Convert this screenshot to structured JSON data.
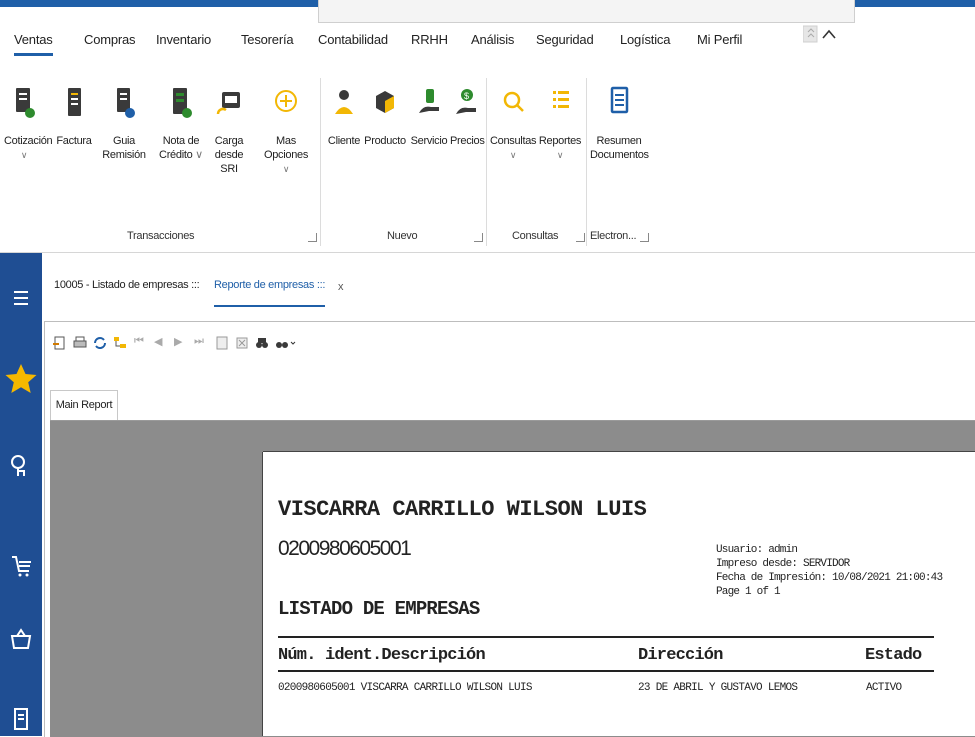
{
  "menu": {
    "tabs": [
      "Ventas",
      "Compras",
      "Inventario",
      "Tesorería",
      "Contabilidad",
      "RRHH",
      "Análisis",
      "Seguridad",
      "Logística",
      "Mi Perfil"
    ],
    "active_tab": "Ventas"
  },
  "ribbon": {
    "transacciones": {
      "label": "Transacciones",
      "buttons": [
        {
          "line1": "Cotización",
          "line2": "",
          "icon": "quote-document-icon"
        },
        {
          "line1": "Factura",
          "line2": "",
          "icon": "invoice-icon"
        },
        {
          "line1": "Guia Remisión",
          "line2": "",
          "icon": "remission-guide-icon"
        },
        {
          "line1": "Nota de",
          "line2": "Crédito",
          "icon": "credit-note-icon"
        },
        {
          "line1": "Carga",
          "line2": "desde SRI",
          "icon": "sri-upload-icon"
        },
        {
          "line1": "Mas Opciones",
          "line2": "",
          "icon": "plus-circle-icon"
        }
      ]
    },
    "nuevo": {
      "label": "Nuevo",
      "buttons": [
        {
          "line1": "Cliente",
          "icon": "client-person-icon"
        },
        {
          "line1": "Producto",
          "icon": "product-box-icon"
        },
        {
          "line1": "Servicio",
          "icon": "service-hand-icon"
        },
        {
          "line1": "Precios",
          "icon": "prices-dollar-icon"
        }
      ]
    },
    "consultas": {
      "label": "Consultas",
      "buttons": [
        {
          "line1": "Consultas",
          "icon": "search-icon"
        },
        {
          "line1": "Reportes",
          "icon": "reports-list-icon"
        }
      ]
    },
    "electron": {
      "label": "Electron...",
      "buttons": [
        {
          "line1": "Resumen",
          "line2": "Documentos",
          "icon": "summary-document-icon"
        }
      ]
    }
  },
  "doc_tabs": [
    {
      "label": "10005 - Listado de empresas :::"
    },
    {
      "label": "Reporte de empresas :::",
      "close": "x"
    }
  ],
  "report_viewer": {
    "main_report_tab": "Main Report"
  },
  "report": {
    "company_name": "VISCARRA CARRILLO WILSON LUIS",
    "company_id": "0200980605001",
    "title": "LISTADO DE EMPRESAS",
    "meta": {
      "usuario": "Usuario: admin",
      "impreso": "Impreso desde: SERVIDOR",
      "fecha": "Fecha de Impresión: 10/08/2021 21:00:43",
      "page": "Page 1 of 1"
    },
    "columns": {
      "ident": "Núm. ident.",
      "descripcion": "Descripción",
      "direccion": "Dirección",
      "estado": "Estado"
    },
    "rows": [
      {
        "ident": "0200980605001",
        "descripcion": "VISCARRA CARRILLO WILSON LUIS",
        "direccion": "23 DE ABRIL Y GUSTAVO LEMOS",
        "estado": "ACTIVO"
      }
    ]
  },
  "colors": {
    "accent": "#1f5fa8",
    "rail": "#1f4e93",
    "star": "#f5b800",
    "ribbon_green": "#2e8b2e",
    "ribbon_yellow": "#f2b705"
  }
}
